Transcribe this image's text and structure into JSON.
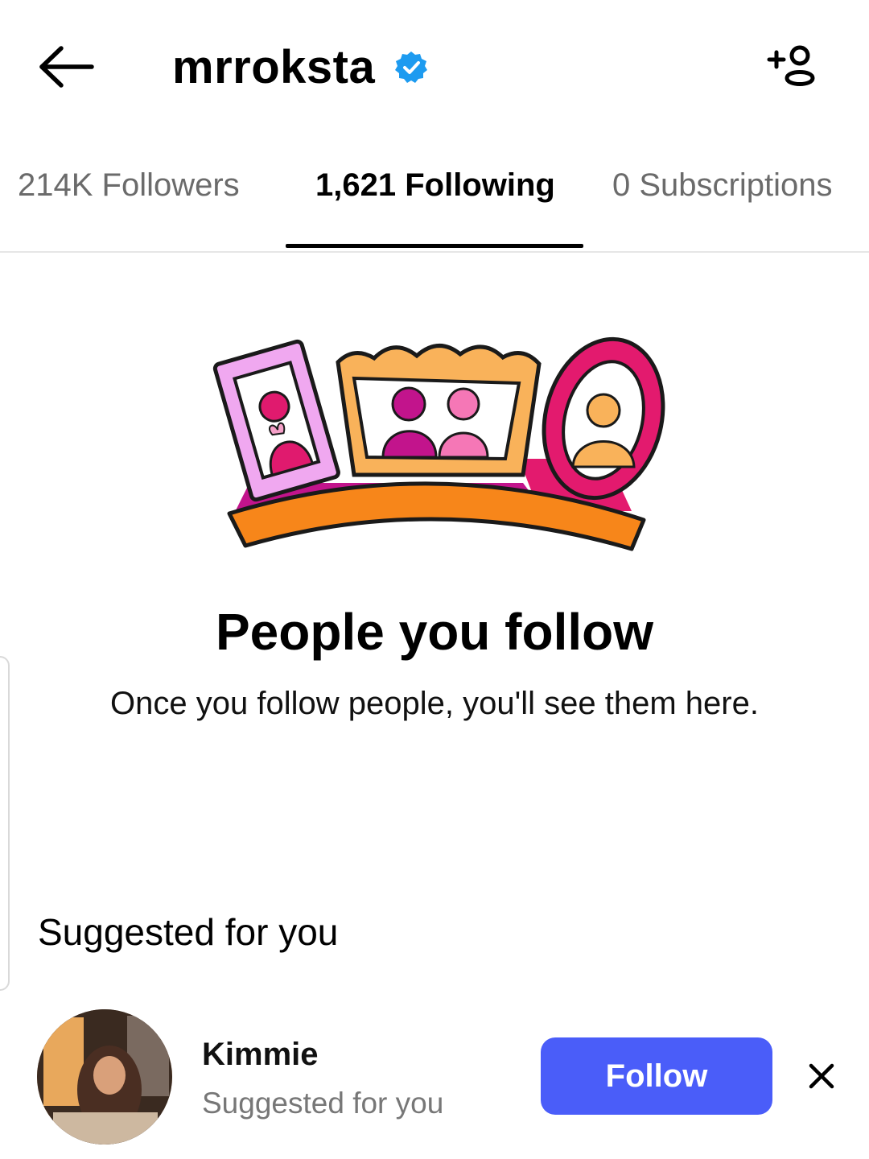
{
  "header": {
    "username": "mrroksta",
    "back_icon": "arrow-left-icon",
    "verified_icon": "verified-badge-icon",
    "add_person_icon": "add-person-icon"
  },
  "tabs": [
    {
      "label": "214K Followers",
      "active": false
    },
    {
      "label": "1,621 Following",
      "active": true
    },
    {
      "label": "0 Subscriptions",
      "active": false
    }
  ],
  "empty_state": {
    "title": "People you follow",
    "subtitle": "Once you follow people, you'll see them here."
  },
  "suggested": {
    "heading": "Suggested for you",
    "items": [
      {
        "name": "Kimmie",
        "meta": "Suggested for you",
        "follow_label": "Follow",
        "dismiss_icon": "close-icon"
      }
    ]
  },
  "colors": {
    "accent": "#4a5df9",
    "verified": "#1d9bf0",
    "text_muted": "#6b6b6b"
  }
}
